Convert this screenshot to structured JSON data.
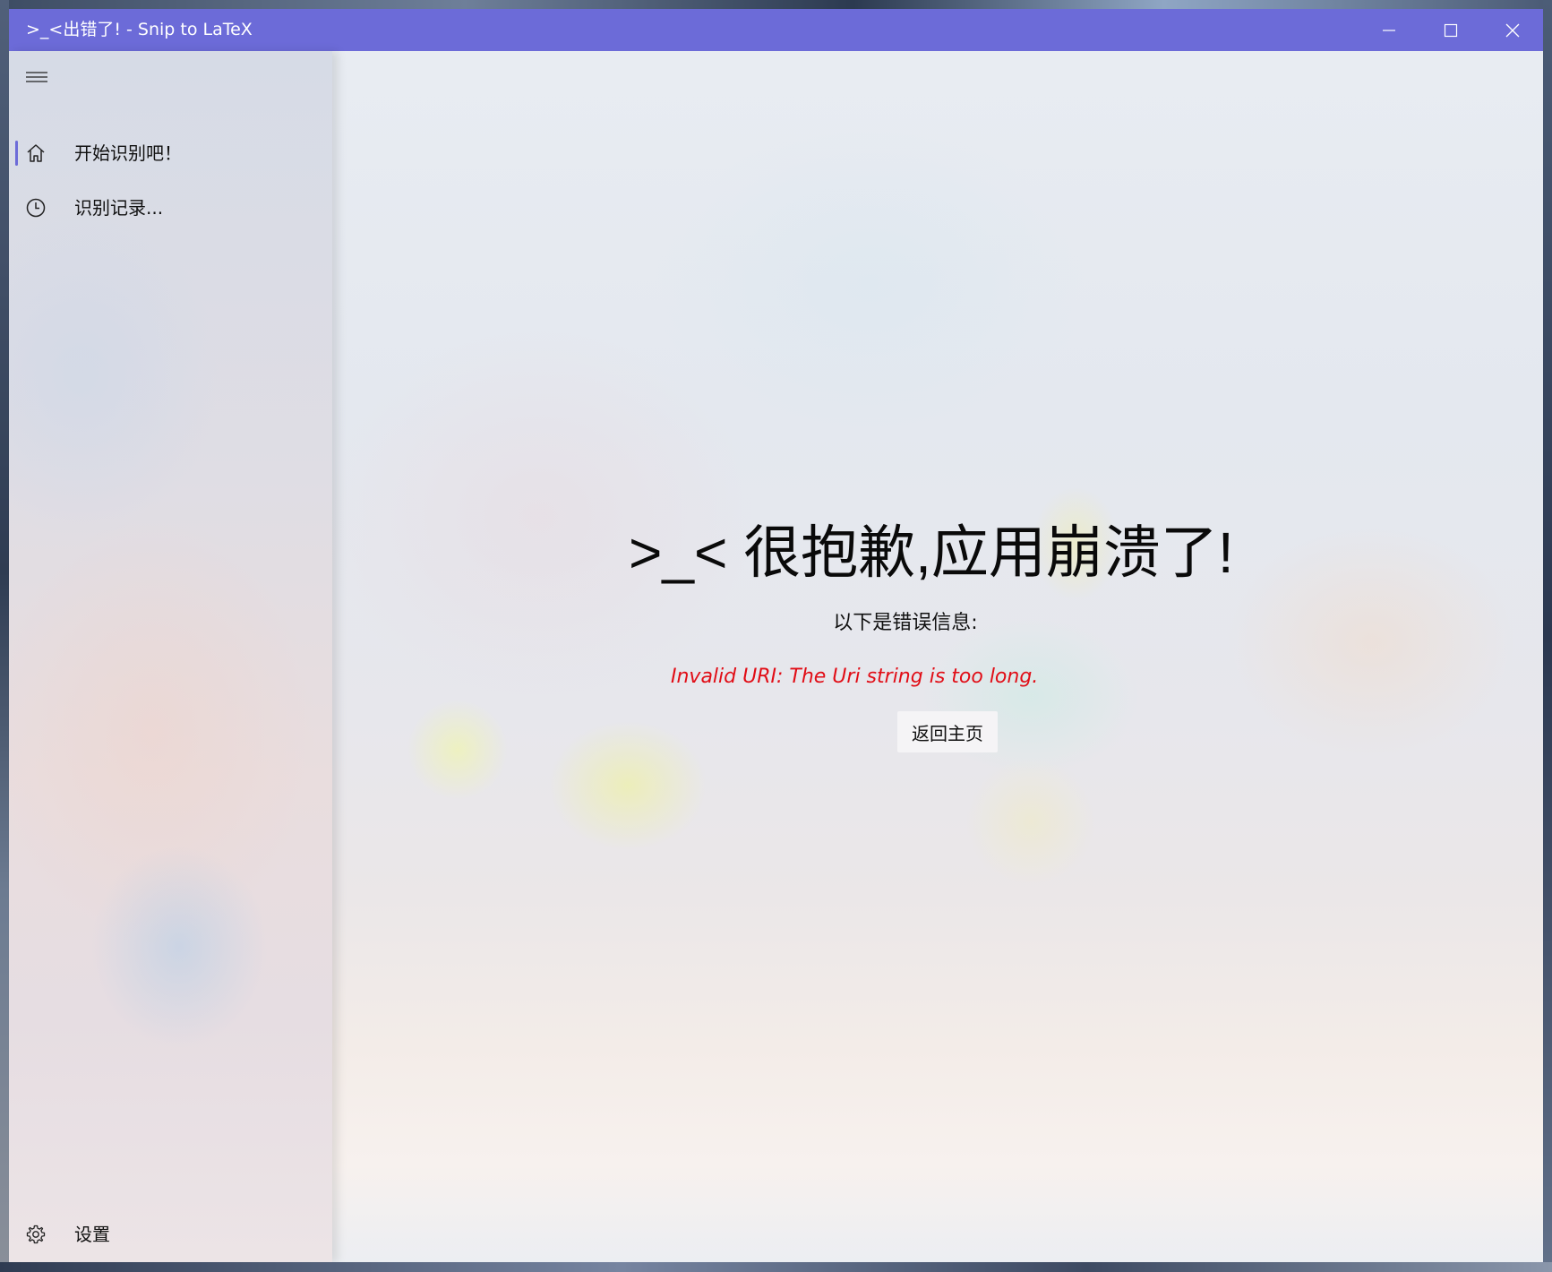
{
  "window": {
    "title": ">_<出错了! - Snip to LaTeX",
    "controls": {
      "minimize_icon": "minimize-icon",
      "maximize_icon": "maximize-icon",
      "close_icon": "close-icon"
    }
  },
  "colors": {
    "accent": "#6c6bd8",
    "error_text": "#e10d16"
  },
  "sidebar": {
    "menu_icon": "hamburger-icon",
    "items": [
      {
        "label": "开始识别吧！",
        "icon": "home-icon",
        "selected": true
      },
      {
        "label": "识别记录...",
        "icon": "clock-icon",
        "selected": false
      }
    ],
    "footer": {
      "label": "设置",
      "icon": "gear-icon"
    }
  },
  "main": {
    "title": ">_< 很抱歉,应用崩溃了!",
    "subtitle": "以下是错误信息:",
    "error_message": "Invalid URI: The Uri string is too long.",
    "back_button_label": "返回主页"
  }
}
